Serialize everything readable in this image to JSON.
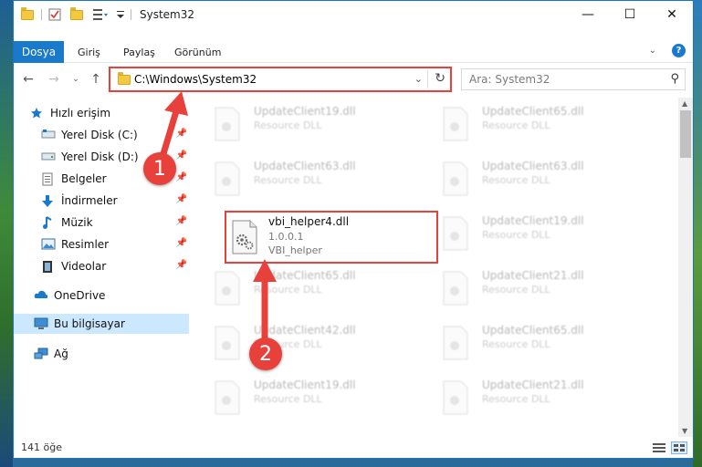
{
  "window": {
    "title": "System32",
    "controls": {
      "minimize": "—",
      "maximize": "☐",
      "close": "✕"
    }
  },
  "ribbon": {
    "tabs": [
      "Dosya",
      "Giriş",
      "Paylaş",
      "Görünüm"
    ],
    "help": "?"
  },
  "nav": {
    "address": "C:\\Windows\\System32",
    "search_placeholder": "Ara: System32"
  },
  "sidebar": {
    "items": [
      {
        "label": "Hızlı erişim",
        "icon": "star-icon"
      },
      {
        "label": "Yerel Disk (C:)",
        "icon": "drive-icon",
        "pinned": true
      },
      {
        "label": "Yerel Disk (D:)",
        "icon": "drive-icon",
        "pinned": true
      },
      {
        "label": "Belgeler",
        "icon": "documents-icon",
        "pinned": true
      },
      {
        "label": "İndirmeler",
        "icon": "download-icon",
        "pinned": true
      },
      {
        "label": "Müzik",
        "icon": "music-icon",
        "pinned": true
      },
      {
        "label": "Resimler",
        "icon": "pictures-icon",
        "pinned": true
      },
      {
        "label": "Videolar",
        "icon": "video-icon",
        "pinned": true
      },
      {
        "label": "OneDrive",
        "icon": "cloud-icon"
      },
      {
        "label": "Bu bilgisayar",
        "icon": "computer-icon",
        "selected": true
      },
      {
        "label": "Ağ",
        "icon": "network-icon"
      }
    ]
  },
  "files": {
    "left": [
      {
        "name": "UpdateClient19.dll",
        "desc": "Resource DLL"
      },
      {
        "name": "UpdateClient63.dll",
        "desc": "Resource DLL"
      },
      {
        "name": "UpdateClient65.dll",
        "desc": "Resource DLL"
      },
      {
        "name": "UpdateClient42.dll",
        "desc": "Resource DLL"
      },
      {
        "name": "UpdateClient19.dll",
        "desc": "Resource DLL"
      }
    ],
    "right": [
      {
        "name": "UpdateClient65.dll",
        "desc": "Resource DLL"
      },
      {
        "name": "UpdateClient63.dll",
        "desc": "Resource DLL"
      },
      {
        "name": "UpdateClient19.dll",
        "desc": "Resource DLL"
      },
      {
        "name": "UpdateClient21.dll",
        "desc": "Resource DLL"
      },
      {
        "name": "UpdateClient65.dll",
        "desc": "Resource DLL"
      },
      {
        "name": "UpdateClient21.dll",
        "desc": "Resource DLL"
      }
    ],
    "highlighted": {
      "name": "vbi_helper4.dll",
      "version": "1.0.0.1",
      "desc": "VBI_helper"
    }
  },
  "status": {
    "count": "141 öğe"
  },
  "annotations": {
    "step1": "1",
    "step2": "2",
    "color": "#e8413b"
  }
}
